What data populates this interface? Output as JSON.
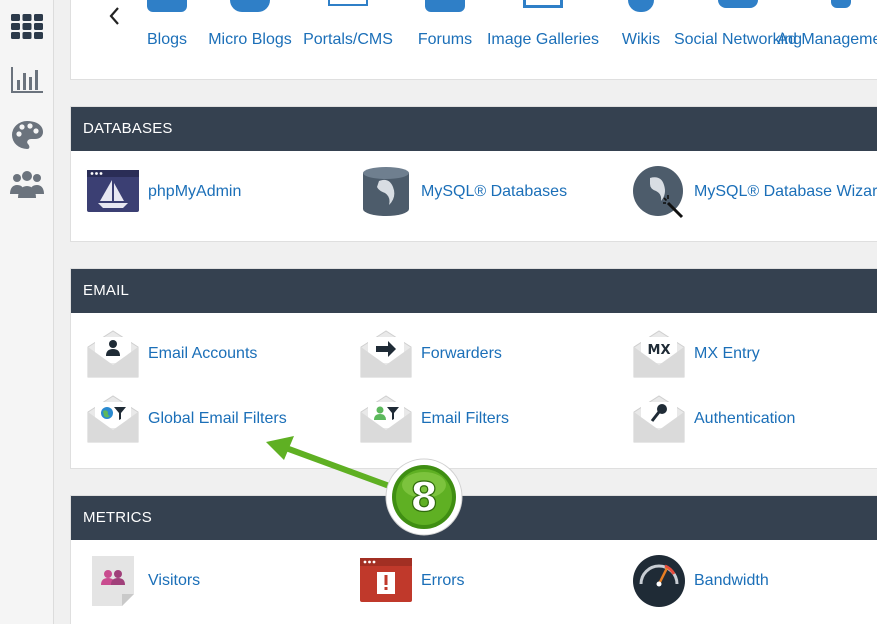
{
  "sidebar": {
    "items": [
      {
        "icon": "grid-icon"
      },
      {
        "icon": "bar-chart-icon"
      },
      {
        "icon": "palette-icon"
      },
      {
        "icon": "users-icon"
      }
    ]
  },
  "apps": {
    "items": [
      {
        "label": "Blogs"
      },
      {
        "label": "Micro Blogs"
      },
      {
        "label": "Portals/CMS"
      },
      {
        "label": "Forums"
      },
      {
        "label": "Image Galleries"
      },
      {
        "label": "Wikis"
      },
      {
        "label": "Social Networking"
      },
      {
        "label": "Ad Management"
      }
    ]
  },
  "databases": {
    "title": "DATABASES",
    "items": [
      {
        "label": "phpMyAdmin",
        "icon": "phpmyadmin-icon"
      },
      {
        "label": "MySQL® Databases",
        "icon": "mysql-database-icon"
      },
      {
        "label": "MySQL® Database Wizard",
        "icon": "mysql-wizard-icon"
      }
    ]
  },
  "email": {
    "title": "EMAIL",
    "items": [
      {
        "label": "Email Accounts",
        "icon": "envelope-user-icon"
      },
      {
        "label": "Forwarders",
        "icon": "envelope-arrow-icon"
      },
      {
        "label": "MX Entry",
        "icon": "envelope-mx-icon"
      },
      {
        "label": "Global Email Filters",
        "icon": "envelope-globe-filter-icon"
      },
      {
        "label": "Email Filters",
        "icon": "envelope-user-filter-icon"
      },
      {
        "label": "Authentication",
        "icon": "envelope-key-icon"
      }
    ]
  },
  "metrics": {
    "title": "METRICS",
    "items": [
      {
        "label": "Visitors",
        "icon": "visitors-icon"
      },
      {
        "label": "Errors",
        "icon": "errors-icon"
      },
      {
        "label": "Bandwidth",
        "icon": "bandwidth-gauge-icon"
      }
    ]
  },
  "annotation": {
    "step": "8"
  },
  "colors": {
    "link": "#1b6fb8",
    "header": "#354150",
    "accent_green": "#5fb023"
  }
}
